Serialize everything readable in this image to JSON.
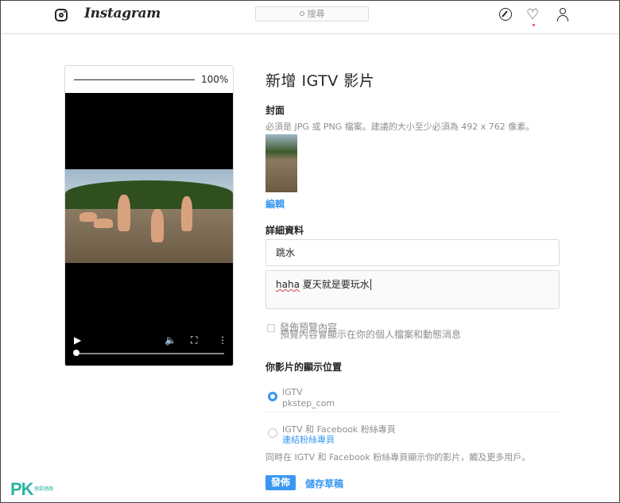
{
  "header": {
    "brand": "Instagram",
    "search_placeholder": "搜尋"
  },
  "player": {
    "progress_percent": "100%",
    "progress_fraction": 1.0
  },
  "form": {
    "title": "新增 IGTV 影片",
    "cover_label": "封面",
    "cover_hint": "必須是 JPG 或 PNG 檔案。建議的大小至少必須為 492 x 762 像素。",
    "edit_label": "編輯",
    "details_label": "詳細資料",
    "title_value": "跳水",
    "description_value_prefix": "haha",
    "description_value_rest": " 夏天就是要玩水",
    "preview_title": "發佈預覽內容",
    "preview_sub": "預覽內容會顯示在你的個人檔案和動態消息",
    "placement_label": "你影片的顯示位置",
    "option1_main": "IGTV",
    "option1_sub": "pkstep_com",
    "option2_main": "IGTV 和 Facebook 粉絲專頁",
    "option2_link": "連結粉絲專頁",
    "footnote": "同時在 IGTV 和 Facebook 粉絲專頁顯示你的影片，觸及更多用戶。",
    "publish_label": "發佈",
    "draft_label": "儲存草稿"
  },
  "watermark": {
    "logo": "PK",
    "sub": "痞凱踏踏"
  },
  "colors": {
    "accent": "#3897f0",
    "border": "#dbdbdb",
    "muted": "#8e8e8e"
  },
  "icons": [
    "instagram-icon",
    "search-icon",
    "compass-icon",
    "heart-icon",
    "user-icon",
    "play-icon",
    "volume-icon",
    "fullscreen-icon",
    "more-icon"
  ]
}
